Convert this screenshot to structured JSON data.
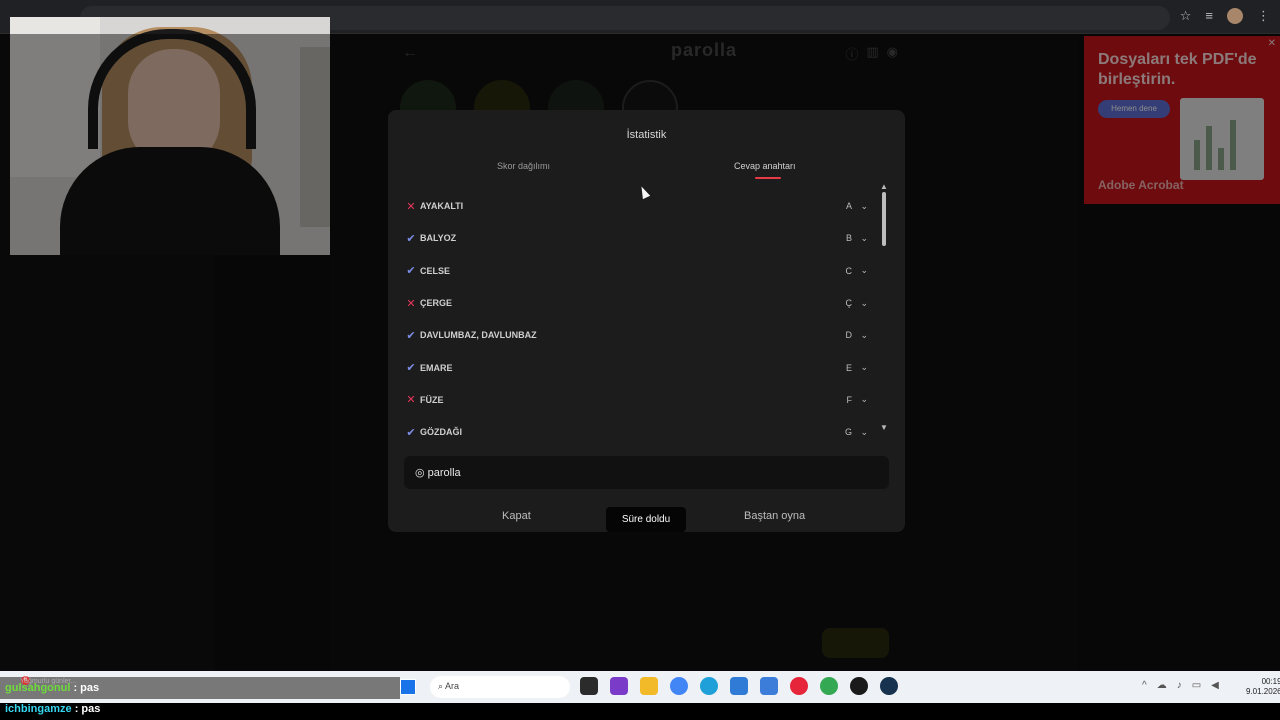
{
  "chat": {
    "notice": "Yağmurlu günler...",
    "badge": "6",
    "messages": [
      {
        "user": "gulsahgonul",
        "text": ": pas"
      },
      {
        "user": "ichbingamze",
        "text": ": pas"
      }
    ]
  },
  "game": {
    "logo": "parolla"
  },
  "ad": {
    "title": "Dosyaları tek PDF'de birleştirin.",
    "button": "Hemen dene",
    "brand": "Adobe Acrobat"
  },
  "modal": {
    "title": "İstatistik",
    "tabs": [
      "Skor dağılımı",
      "Cevap anahtarı"
    ],
    "active_tab": "Cevap anahtarı",
    "answers": [
      {
        "status": "wrong",
        "word": "AYAKALTI",
        "letter": "A"
      },
      {
        "status": "correct",
        "word": "BALYOZ",
        "letter": "B"
      },
      {
        "status": "correct",
        "word": "CELSE",
        "letter": "C"
      },
      {
        "status": "wrong",
        "word": "ÇERGE",
        "letter": "Ç"
      },
      {
        "status": "correct",
        "word": "DAVLUMBAZ, DAVLUNBAZ",
        "letter": "D"
      },
      {
        "status": "correct",
        "word": "EMARE",
        "letter": "E"
      },
      {
        "status": "wrong",
        "word": "FÜZE",
        "letter": "F"
      },
      {
        "status": "correct",
        "word": "GÖZDAĞI",
        "letter": "G"
      }
    ],
    "share_text": "◎ parolla",
    "close_label": "Kapat",
    "timeout_label": "Süre doldu",
    "restart_label": "Baştan oyna"
  },
  "taskbar": {
    "search_placeholder": "Ara",
    "time": "00:19",
    "date": "9.01.2026"
  },
  "colors": {
    "wrong": "#e6365a",
    "correct": "#7b8fe8",
    "accent_underline": "#e63a46"
  }
}
